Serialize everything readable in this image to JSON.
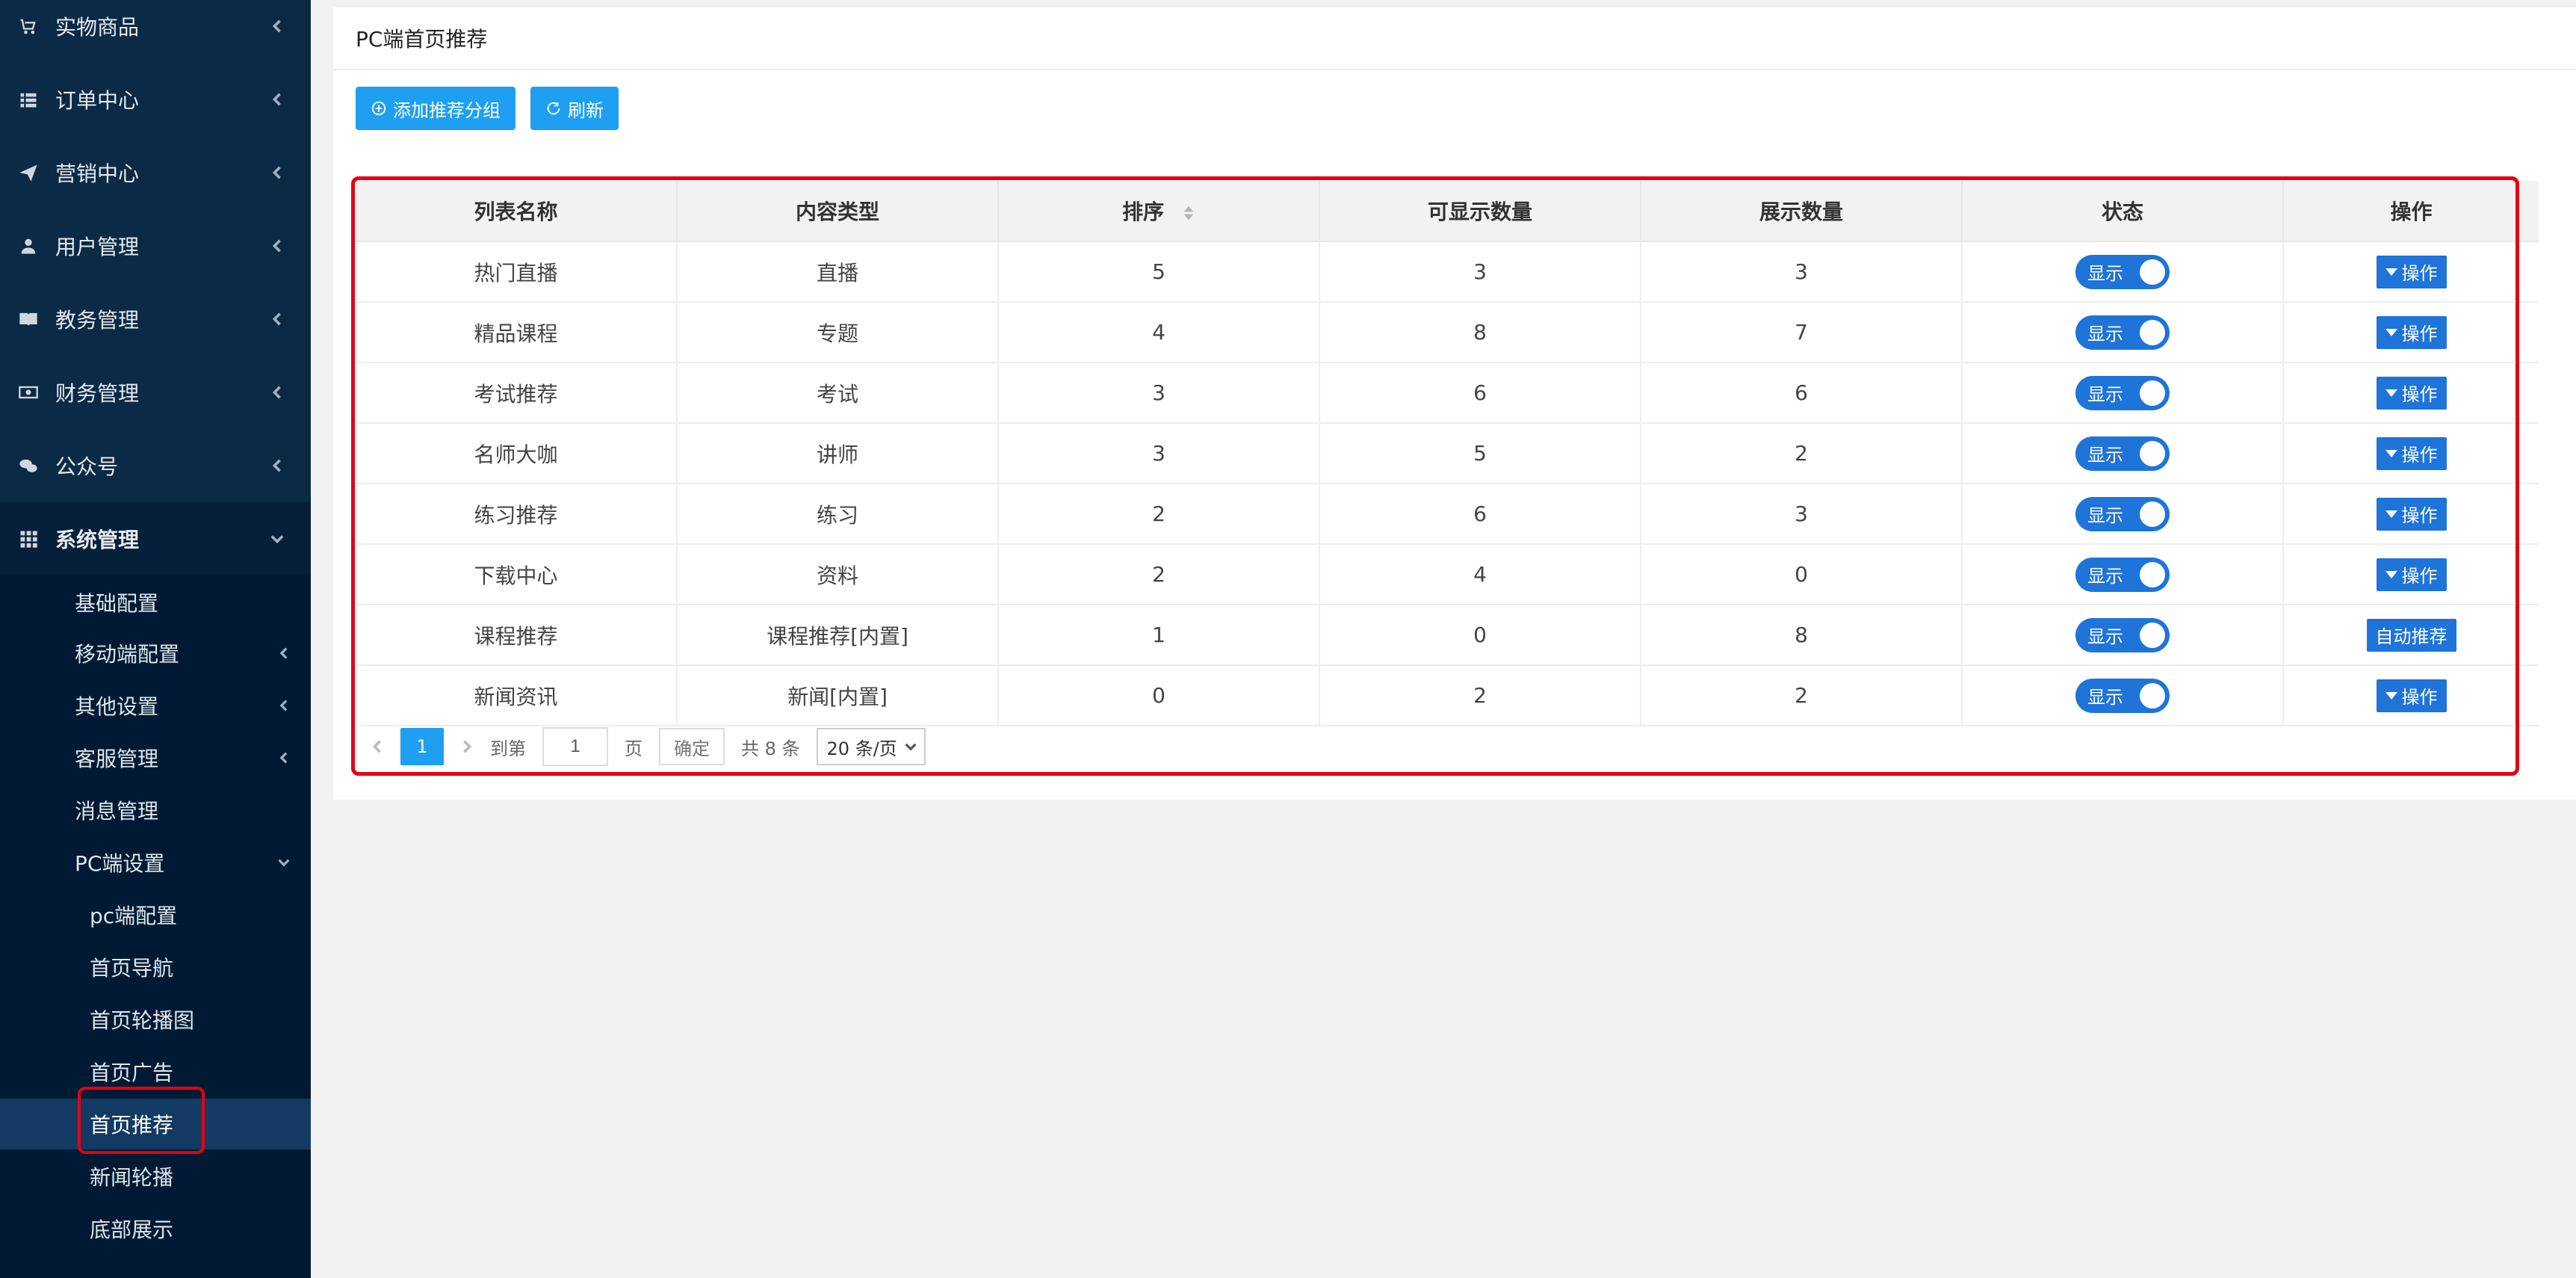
{
  "sidebar": {
    "items": [
      {
        "label": "实物商品",
        "icon": "cart-icon"
      },
      {
        "label": "订单中心",
        "icon": "list-icon"
      },
      {
        "label": "营销中心",
        "icon": "paper-plane-icon"
      },
      {
        "label": "用户管理",
        "icon": "user-icon"
      },
      {
        "label": "教务管理",
        "icon": "book-icon"
      },
      {
        "label": "财务管理",
        "icon": "money-icon"
      },
      {
        "label": "公众号",
        "icon": "wechat-icon"
      },
      {
        "label": "系统管理",
        "icon": "grid-icon"
      }
    ],
    "system_sub": [
      {
        "label": "基础配置"
      },
      {
        "label": "移动端配置"
      },
      {
        "label": "其他设置"
      },
      {
        "label": "客服管理"
      },
      {
        "label": "消息管理"
      },
      {
        "label": "PC端设置"
      }
    ],
    "pc_sub": [
      {
        "label": "pc端配置"
      },
      {
        "label": "首页导航"
      },
      {
        "label": "首页轮播图"
      },
      {
        "label": "首页广告"
      },
      {
        "label": "首页推荐"
      },
      {
        "label": "新闻轮播"
      },
      {
        "label": "底部展示"
      }
    ]
  },
  "main": {
    "title": "PC端首页推荐",
    "buttons": {
      "add_label": "添加推荐分组",
      "refresh_label": "刷新"
    },
    "table": {
      "columns": [
        "列表名称",
        "内容类型",
        "排序",
        "可显示数量",
        "展示数量",
        "状态",
        "操作"
      ],
      "rows": [
        {
          "name": "热门直播",
          "type": "直播",
          "order": "5",
          "visible": "3",
          "shown": "3",
          "status": "显示",
          "op": "操作"
        },
        {
          "name": "精品课程",
          "type": "专题",
          "order": "4",
          "visible": "8",
          "shown": "7",
          "status": "显示",
          "op": "操作"
        },
        {
          "name": "考试推荐",
          "type": "考试",
          "order": "3",
          "visible": "6",
          "shown": "6",
          "status": "显示",
          "op": "操作"
        },
        {
          "name": "名师大咖",
          "type": "讲师",
          "order": "3",
          "visible": "5",
          "shown": "2",
          "status": "显示",
          "op": "操作"
        },
        {
          "name": "练习推荐",
          "type": "练习",
          "order": "2",
          "visible": "6",
          "shown": "3",
          "status": "显示",
          "op": "操作"
        },
        {
          "name": "下载中心",
          "type": "资料",
          "order": "2",
          "visible": "4",
          "shown": "0",
          "status": "显示",
          "op": "操作"
        },
        {
          "name": "课程推荐",
          "type": "课程推荐[内置]",
          "order": "1",
          "visible": "0",
          "shown": "8",
          "status": "显示",
          "op": "自动推荐"
        },
        {
          "name": "新闻资讯",
          "type": "新闻[内置]",
          "order": "0",
          "visible": "2",
          "shown": "2",
          "status": "显示",
          "op": "操作"
        }
      ]
    },
    "pager": {
      "current": "1",
      "goto_label": "到第",
      "page_label": "页",
      "input_value": "1",
      "confirm_label": "确定",
      "total_label": "共 8 条",
      "page_size": "20 条/页"
    }
  },
  "colors": {
    "sidebar_bg": "#001a33",
    "accent": "#1e9ff2",
    "switch_blue": "#1e74d9",
    "highlight_red": "#e60012"
  }
}
